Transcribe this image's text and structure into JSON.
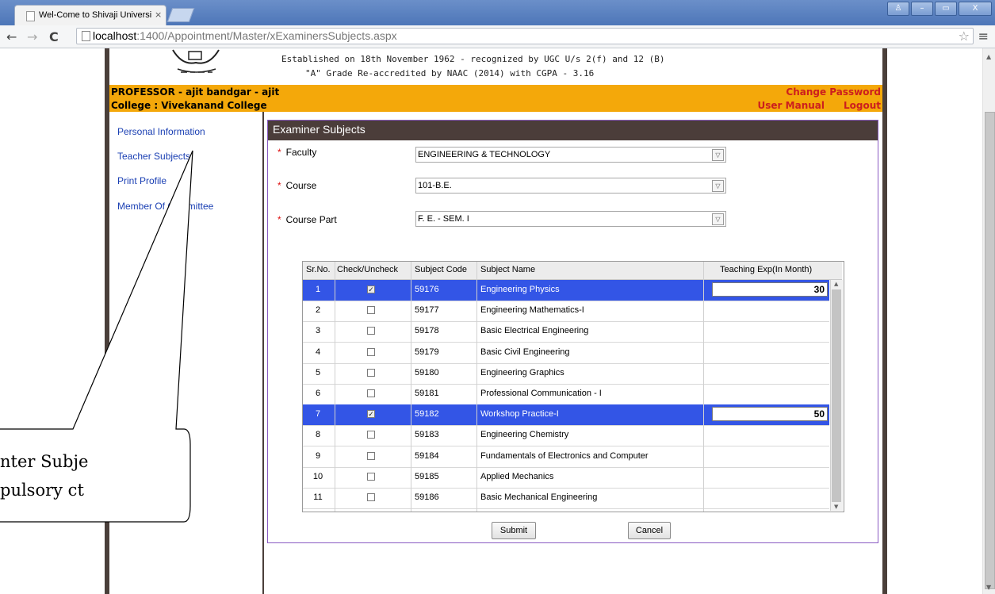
{
  "browser": {
    "tab_title": "Wel-Come to Shivaji Universi",
    "tab_close": "×",
    "url_host": "localhost",
    "url_path": ":1400/Appointment/Master/xExaminersSubjects.aspx",
    "back_glyph": "←",
    "forward_glyph": "→",
    "reload_glyph": "C",
    "star_glyph": "☆",
    "menu_glyph": "≡",
    "win_user": "♙",
    "win_min": "–",
    "win_max": "▭",
    "win_close": "X"
  },
  "header": {
    "line1": "Established on 18th November 1962 - recognized by UGC U/s 2(f) and 12 (B)",
    "line2": "\"A\" Grade Re-accredited by NAAC (2014) with CGPA - 3.16"
  },
  "userbar": {
    "role_line": "PROFESSOR - ajit bandgar - ajit",
    "college_line": "College : Vivekanand College",
    "change_password": "Change Password",
    "user_manual": "User Manual",
    "logout": "Logout"
  },
  "sidebar": {
    "items": [
      {
        "label": "Personal Information"
      },
      {
        "label": "Teacher Subjects"
      },
      {
        "label": "Print Profile"
      },
      {
        "label": "Member Of Committee"
      }
    ]
  },
  "panel": {
    "title": "Examiner Subjects",
    "required_mark": "*",
    "faculty_label": "Faculty",
    "faculty_value": "ENGINEERING & TECHNOLOGY",
    "course_label": "Course",
    "course_value": "101-B.E.",
    "course_part_label": "Course Part",
    "course_part_value": "F. E. - SEM. I",
    "dropdown_glyph": "▽"
  },
  "grid": {
    "headers": [
      "Sr.No.",
      "Check/Uncheck",
      "Subject Code",
      "Subject Name",
      "Teaching Exp(In Month)"
    ],
    "rows": [
      {
        "sr": "1",
        "checked": true,
        "code": "59176",
        "name": "Engineering Physics",
        "exp": "30"
      },
      {
        "sr": "2",
        "checked": false,
        "code": "59177",
        "name": "Engineering Mathematics-I",
        "exp": ""
      },
      {
        "sr": "3",
        "checked": false,
        "code": "59178",
        "name": "Basic Electrical Engineering",
        "exp": ""
      },
      {
        "sr": "4",
        "checked": false,
        "code": "59179",
        "name": "Basic Civil Engineering",
        "exp": ""
      },
      {
        "sr": "5",
        "checked": false,
        "code": "59180",
        "name": "Engineering Graphics",
        "exp": ""
      },
      {
        "sr": "6",
        "checked": false,
        "code": "59181",
        "name": "Professional Communication - I",
        "exp": ""
      },
      {
        "sr": "7",
        "checked": true,
        "code": "59182",
        "name": "Workshop Practice-I",
        "exp": "50"
      },
      {
        "sr": "8",
        "checked": false,
        "code": "59183",
        "name": "Engineering Chemistry",
        "exp": ""
      },
      {
        "sr": "9",
        "checked": false,
        "code": "59184",
        "name": "Fundamentals of Electronics and Computer",
        "exp": ""
      },
      {
        "sr": "10",
        "checked": false,
        "code": "59185",
        "name": "Applied Mechanics",
        "exp": ""
      },
      {
        "sr": "11",
        "checked": false,
        "code": "59186",
        "name": "Basic Mechanical Engineering",
        "exp": ""
      }
    ],
    "check_glyph": "✓"
  },
  "actions": {
    "submit": "Submit",
    "cancel": "Cancel"
  },
  "callout": {
    "line1": "nter Subje",
    "line2": "pulsory ct"
  },
  "colors": {
    "accent_orange": "#f4a80a",
    "selection_blue": "#3355e6",
    "link_blue": "#1a3fb3",
    "panel_header": "#4b3d3a"
  }
}
